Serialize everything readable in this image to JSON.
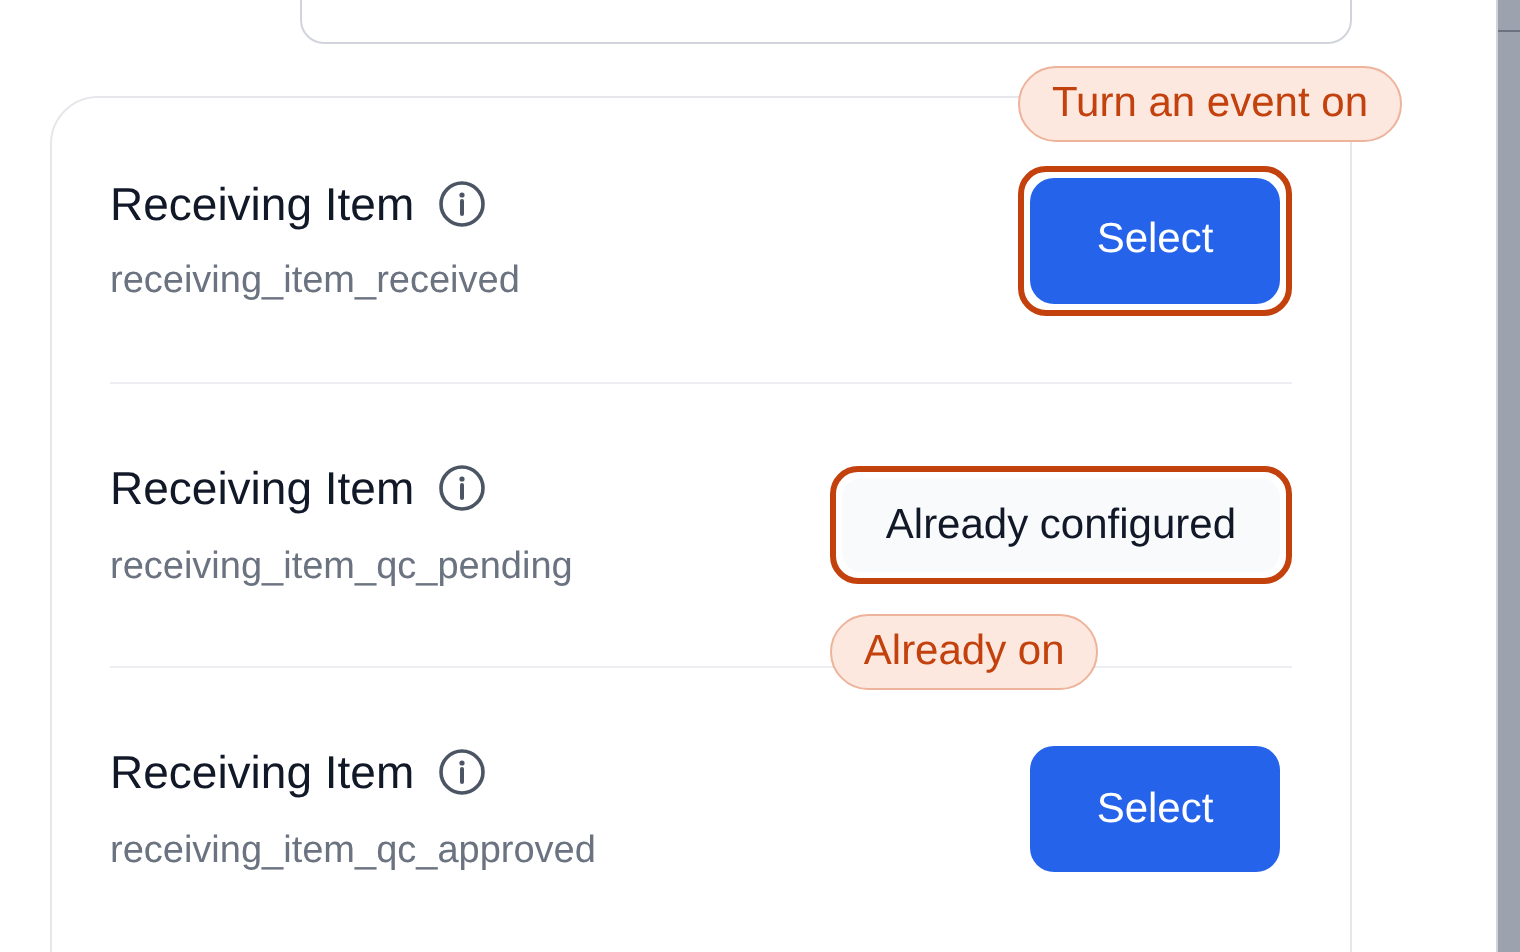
{
  "events": [
    {
      "title": "Receiving Item",
      "key": "receiving_item_received",
      "action": {
        "kind": "button",
        "label": "Select"
      },
      "highlighted": true,
      "callout": "Turn an event on"
    },
    {
      "title": "Receiving Item",
      "key": "receiving_item_qc_pending",
      "action": {
        "kind": "status",
        "label": "Already configured"
      },
      "highlighted": true,
      "callout": "Already on"
    },
    {
      "title": "Receiving Item",
      "key": "receiving_item_qc_approved",
      "action": {
        "kind": "button",
        "label": "Select"
      },
      "highlighted": false
    }
  ]
}
